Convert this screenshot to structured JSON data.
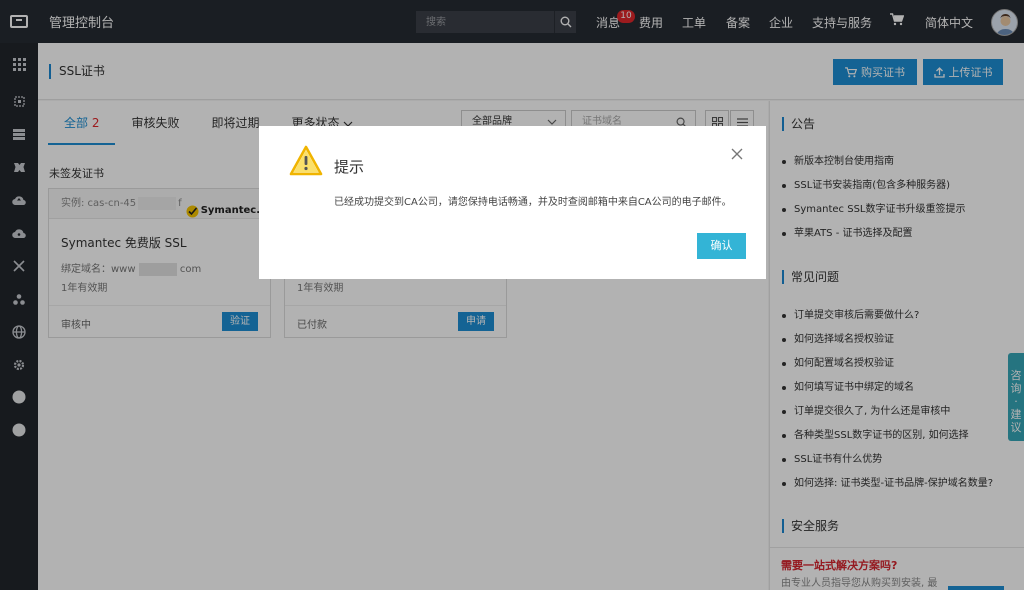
{
  "topbar": {
    "app_title": "管理控制台",
    "search_placeholder": "搜索",
    "nav": {
      "messages": "消息",
      "message_count": "10",
      "billing": "费用",
      "tickets": "工单",
      "filing": "备案",
      "enterprise": "企业",
      "support": "支持与服务",
      "language": "简体中文"
    },
    "cart_icon": "cart-icon"
  },
  "sidebar": {
    "items": [
      "apps-grid-icon",
      "box-icon",
      "list-icon",
      "cube-icon",
      "cloud-up-icon",
      "cloud-icon",
      "cross-icon",
      "cluster-icon",
      "globe-icon",
      "gear-icon",
      "circle-icon",
      "circle-icon"
    ]
  },
  "page": {
    "title": "SSL证书",
    "buy_button": "购买证书",
    "upload_button": "上传证书"
  },
  "tabs": {
    "all": "全部",
    "all_count": "2",
    "audit_failed": "审核失败",
    "expiring": "即将过期",
    "more_status": "更多状态"
  },
  "filters": {
    "brand": "全部品牌",
    "domain_placeholder": "证书域名"
  },
  "section": {
    "unissued": "未签发证书"
  },
  "cards": [
    {
      "instance": "实例: cas-cn-45",
      "instance_tail": "f",
      "brand": "Symantec.",
      "name": "Symantec 免费版 SSL",
      "domain_label": "绑定域名：www",
      "domain_tail": "com",
      "validity": "1年有效期",
      "status": "审核中",
      "action": "验证"
    },
    {
      "validity": "1年有效期",
      "status": "已付款",
      "action": "申请"
    }
  ],
  "right_panel": {
    "announcements_title": "公告",
    "announcements": [
      "新版本控制台使用指南",
      "SSL证书安装指南(包含多种服务器)",
      "Symantec SSL数字证书升级重签提示",
      "苹果ATS - 证书选择及配置"
    ],
    "faq_title": "常见问题",
    "faq": [
      "订单提交审核后需要做什么?",
      "如何选择域名授权验证",
      "如何配置域名授权验证",
      "如何填写证书中绑定的域名",
      "订单提交很久了, 为什么还是审核中",
      "各种类型SSL数字证书的区别, 如何选择",
      "SSL证书有什么优势",
      "如何选择: 证书类型-证书品牌-保护域名数量?"
    ],
    "security_title": "安全服务",
    "promo_title": "需要一站式解决方案吗?",
    "promo_text": "由专业人员指导您从购买到安装, 最"
  },
  "consult_tab": "咨\n询\n·\n建\n议",
  "modal": {
    "title": "提示",
    "message": "已经成功提交到CA公司，请您保持电话畅通，并及时查阅邮箱中来自CA公司的电子邮件。",
    "confirm": "确认"
  },
  "colors": {
    "topbar": "#262b33",
    "accent": "#1d8fd4",
    "confirm": "#33b4d6",
    "badge": "#e0272c"
  }
}
